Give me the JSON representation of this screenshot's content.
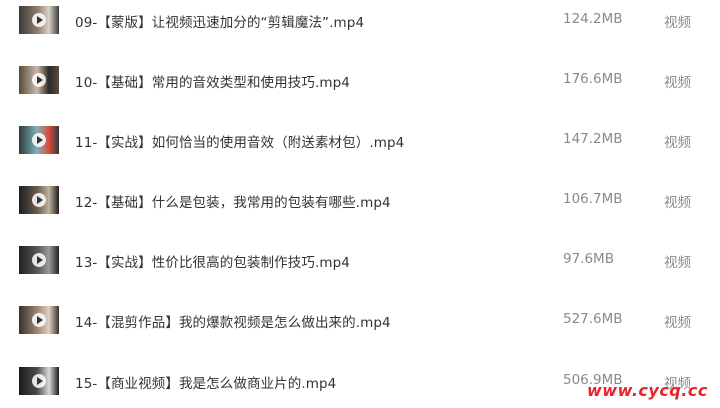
{
  "files": [
    {
      "name": "09-【蒙版】让视频迅速加分的“剪辑魔法”.mp4",
      "size": "124.2MB",
      "type": "视频",
      "thumb_colors": [
        "#3b3b3b",
        "#8c7a6a",
        "#d9d2c8"
      ]
    },
    {
      "name": "10-【基础】常用的音效类型和使用技巧.mp4",
      "size": "176.6MB",
      "type": "视频",
      "thumb_colors": [
        "#5a4a3e",
        "#c9b8a8",
        "#2f2a26"
      ]
    },
    {
      "name": "11-【实战】如何恰当的使用音效（附送素材包）.mp4",
      "size": "147.2MB",
      "type": "视频",
      "thumb_colors": [
        "#2d3a40",
        "#7fb2b8",
        "#d94a3a"
      ]
    },
    {
      "name": "12-【基础】什么是包装，我常用的包装有哪些.mp4",
      "size": "106.7MB",
      "type": "视频",
      "thumb_colors": [
        "#1e1e1e",
        "#6b5a4c",
        "#bfb0a0"
      ]
    },
    {
      "name": "13-【实战】性价比很高的包装制作技巧.mp4",
      "size": "97.6MB",
      "type": "视频",
      "thumb_colors": [
        "#222222",
        "#555555",
        "#9a9a9a"
      ]
    },
    {
      "name": "14-【混剪作品】我的爆款视频是怎么做出来的.mp4",
      "size": "527.6MB",
      "type": "视频",
      "thumb_colors": [
        "#3a2f28",
        "#a08470",
        "#e0d0c0"
      ]
    },
    {
      "name": "15-【商业视频】我是怎么做商业片的.mp4",
      "size": "506.9MB",
      "type": "视频",
      "thumb_colors": [
        "#1c1c1c",
        "#4a4a4a",
        "#d8d8d8"
      ]
    }
  ],
  "watermark": "www.cycq.cc",
  "colors": {
    "name": "#333333",
    "meta": "#8a8a8a",
    "watermark": "#e8232a"
  }
}
